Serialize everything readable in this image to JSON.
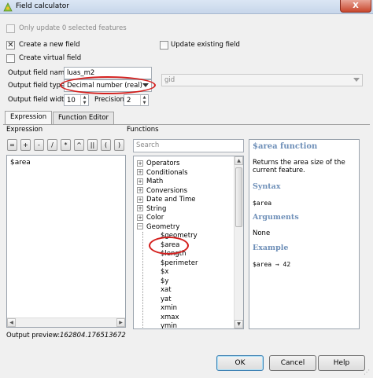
{
  "window": {
    "title": "Field calculator",
    "close_label": "X"
  },
  "options": {
    "only_update_selected": "Only update 0 selected features",
    "create_new_field": "Create a new field",
    "update_existing_field": "Update existing field",
    "create_virtual_field": "Create virtual field"
  },
  "fields": {
    "output_name_label": "Output field name",
    "output_name_value": "luas_m2",
    "output_type_label": "Output field type",
    "output_type_value": "Decimal number (real)",
    "width_label": "Output field width",
    "width_value": "10",
    "precision_label": "Precision",
    "precision_value": "2",
    "existing_field_value": "gid"
  },
  "tabs": [
    "Expression",
    "Function Editor"
  ],
  "expression": {
    "header": "Expression",
    "operators": [
      "=",
      "+",
      "-",
      "/",
      "*",
      "^",
      "||",
      "(",
      ")"
    ],
    "text": "$area"
  },
  "functions": {
    "header": "Functions",
    "search_placeholder": "Search",
    "groups": [
      "Operators",
      "Conditionals",
      "Math",
      "Conversions",
      "Date and Time",
      "String",
      "Color"
    ],
    "open_group": "Geometry",
    "geometry_items": [
      "$geometry",
      "$area",
      "$length",
      "$perimeter",
      "$x",
      "$y",
      "xat",
      "yat",
      "xmin",
      "xmax",
      "ymin"
    ]
  },
  "help": {
    "title": "$area function",
    "description": "Returns the area size of the current feature.",
    "syntax_heading": "Syntax",
    "syntax": "$area",
    "arguments_heading": "Arguments",
    "arguments": "None",
    "example_heading": "Example",
    "example": "$area → 42"
  },
  "preview": {
    "label": "Output preview:",
    "value": "162804.176513672"
  },
  "buttons": {
    "ok": "OK",
    "cancel": "Cancel",
    "help": "Help"
  }
}
